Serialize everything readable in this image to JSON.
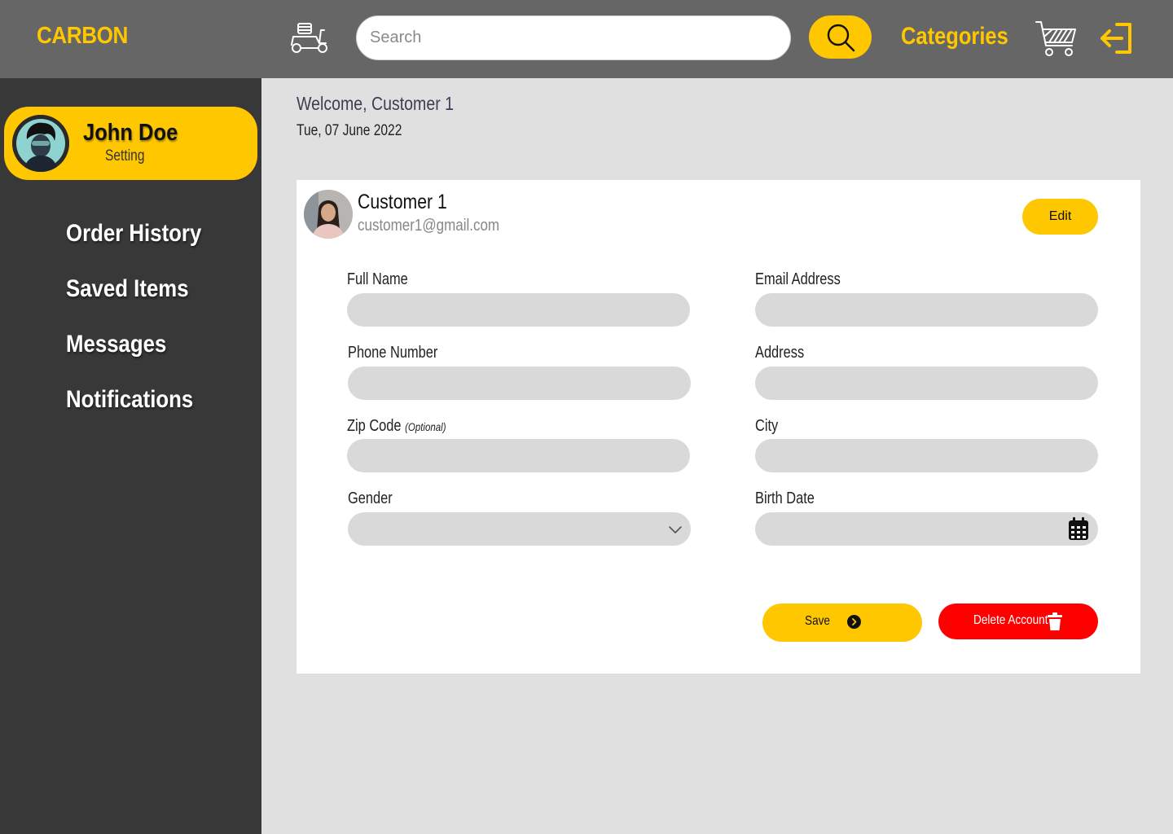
{
  "header": {
    "logo": "CARBON",
    "search_placeholder": "Search",
    "categories_label": "Categories",
    "icons": [
      "scooter-icon",
      "search-icon",
      "cart-icon",
      "logout-icon"
    ]
  },
  "sidebar": {
    "profile": {
      "name": "John Doe",
      "subtitle": "Setting"
    },
    "items": [
      {
        "label": "Order History"
      },
      {
        "label": "Saved Items"
      },
      {
        "label": "Messages"
      },
      {
        "label": "Notifications"
      }
    ]
  },
  "main": {
    "welcome": "Welcome, Customer 1",
    "date": "Tue, 07 June 2022",
    "card": {
      "name": "Customer 1",
      "email": "customer1@gmail.com",
      "edit_label": "Edit"
    },
    "form": {
      "full_name": {
        "label": "Full Name",
        "value": ""
      },
      "email": {
        "label": "Email Address",
        "value": ""
      },
      "phone": {
        "label": "Phone Number",
        "value": ""
      },
      "address": {
        "label": "Address",
        "value": ""
      },
      "zip": {
        "label": "Zip Code",
        "optional": "(Optional)",
        "value": ""
      },
      "city": {
        "label": "City",
        "value": ""
      },
      "gender": {
        "label": "Gender",
        "value": ""
      },
      "birth_date": {
        "label": "Birth Date",
        "value": ""
      }
    },
    "actions": {
      "save_label": "Save",
      "delete_label": "Delete Account"
    }
  },
  "colors": {
    "accent": "#ffc700",
    "header_bg": "#666666",
    "sidebar_bg": "#383838",
    "content_bg": "#e0e0e0",
    "danger": "#ff0000",
    "field_bg": "#d9d9d9"
  }
}
